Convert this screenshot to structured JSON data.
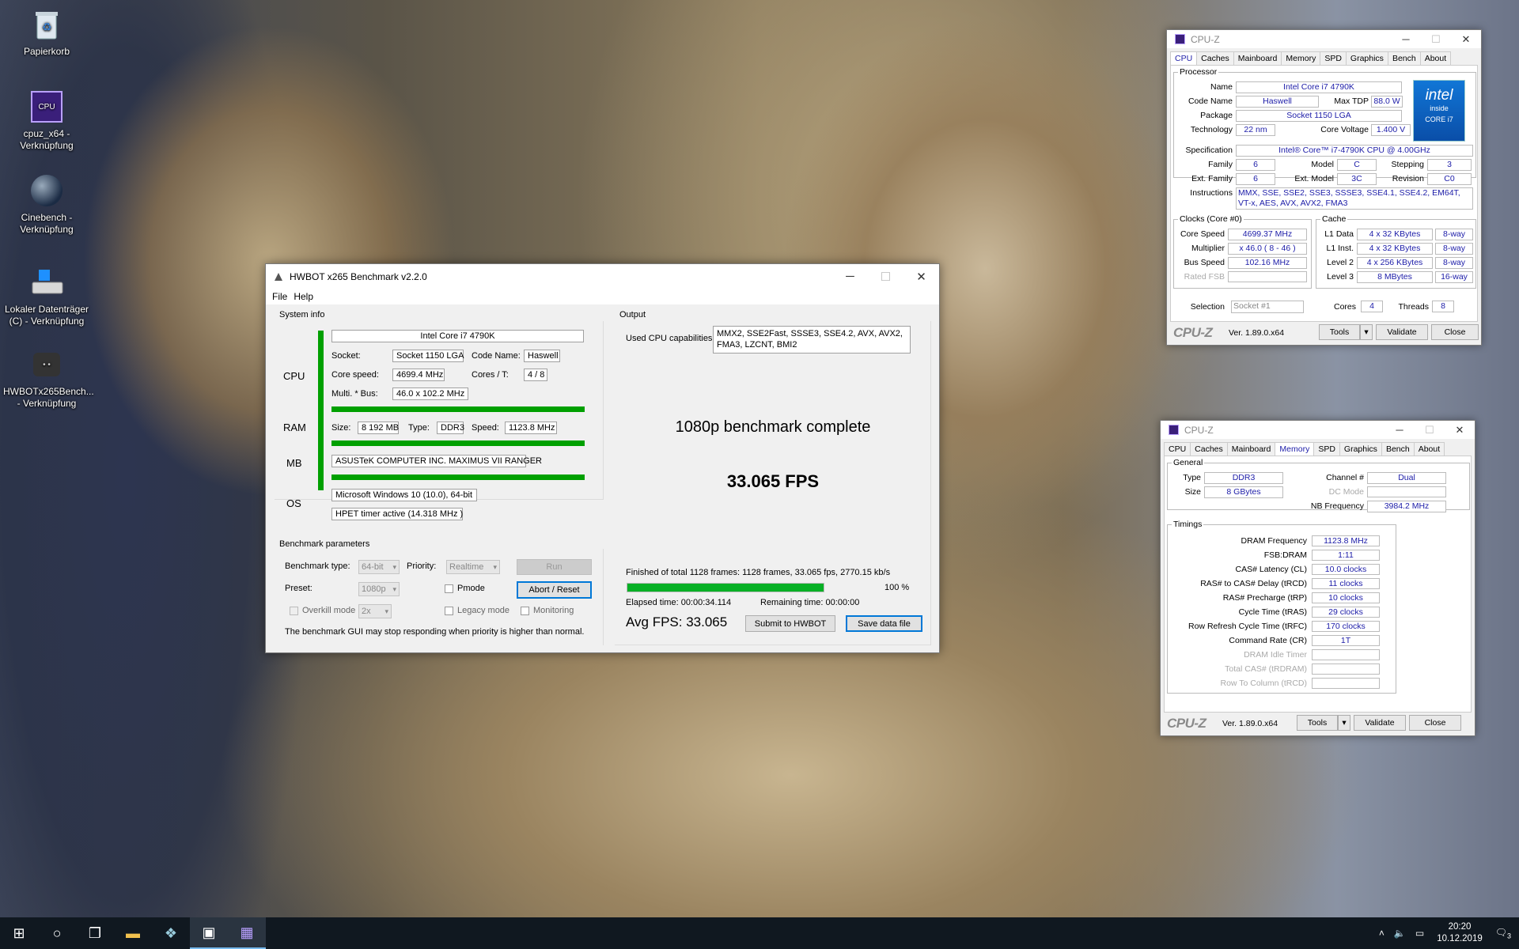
{
  "desktop": {
    "icons": [
      {
        "label": "Papierkorb",
        "icon": "recycle-bin-icon"
      },
      {
        "label": "cpuz_x64 - Verknüpfung",
        "icon": "cpuz-icon"
      },
      {
        "label": "Cinebench - Verknüpfung",
        "icon": "cinebench-icon"
      },
      {
        "label": "Lokaler Datenträger (C) - Verknüpfung",
        "icon": "drive-icon"
      },
      {
        "label": "HWBOTx265Bench... - Verknüpfung",
        "icon": "hwbot-icon"
      }
    ]
  },
  "hwbot": {
    "title": "HWBOT x265 Benchmark v2.2.0",
    "menu": [
      "File",
      "Help"
    ],
    "sysinfo": {
      "title": "System info",
      "cpu_label": "CPU",
      "ram_label": "RAM",
      "mb_label": "MB",
      "os_label": "OS",
      "cpu_name": "Intel Core i7 4790K",
      "socket_label": "Socket:",
      "socket": "Socket 1150 LGA",
      "codename_label": "Code Name:",
      "codename": "Haswell",
      "corespeed_label": "Core speed:",
      "corespeed": "4699.4 MHz",
      "cores_label": "Cores / T:",
      "cores": "4 / 8",
      "multi_label": "Multi. * Bus:",
      "multi": "46.0 x 102.2 MHz",
      "size_label": "Size:",
      "size": "8 192 MB",
      "type_label": "Type:",
      "type": "DDR3",
      "speed_label": "Speed:",
      "speed": "1123.8 MHz",
      "mb": "ASUSTeK COMPUTER INC. MAXIMUS VII RANGER",
      "os": "Microsoft Windows 10 (10.0), 64-bit",
      "timer": "HPET timer active (14.318 MHz )"
    },
    "params": {
      "title": "Benchmark parameters",
      "type_label": "Benchmark type:",
      "type": "64-bit",
      "priority_label": "Priority:",
      "priority": "Realtime",
      "run": "Run",
      "preset_label": "Preset:",
      "preset": "1080p",
      "pmode": "Pmode",
      "abort": "Abort / Reset",
      "overkill": "Overkill mode",
      "overkill_val": "2x",
      "legacy": "Legacy mode",
      "monitoring": "Monitoring",
      "note": "The benchmark GUI may stop responding when priority is higher than normal."
    },
    "output": {
      "title": "Output",
      "caps_label": "Used CPU capabilities:",
      "caps": "MMX2, SSE2Fast, SSSE3, SSE4.2, AVX, AVX2, FMA3, LZCNT, BMI2",
      "status": "1080p benchmark complete",
      "fps": "33.065 FPS",
      "finished": "Finished of total 1128 frames: 1128 frames, 33.065 fps,  2770.15 kb/s",
      "progress": 1.0,
      "progress_text": "100 %",
      "elapsed": "Elapsed time: 00:00:34.114",
      "remaining": "Remaining time: 00:00:00",
      "avg": "Avg FPS: 33.065",
      "submit": "Submit to HWBOT",
      "save": "Save data file"
    }
  },
  "cpuz_cpu": {
    "title": "CPU-Z",
    "tabs": [
      "CPU",
      "Caches",
      "Mainboard",
      "Memory",
      "SPD",
      "Graphics",
      "Bench",
      "About"
    ],
    "active": "CPU",
    "processor": "Processor",
    "name_l": "Name",
    "name": "Intel Core i7 4790K",
    "code_l": "Code Name",
    "code": "Haswell",
    "tdp_l": "Max TDP",
    "tdp": "88.0 W",
    "pkg_l": "Package",
    "pkg": "Socket 1150 LGA",
    "tech_l": "Technology",
    "tech": "22 nm",
    "volt_l": "Core Voltage",
    "volt": "1.400 V",
    "spec_l": "Specification",
    "spec": "Intel® Core™ i7-4790K CPU @ 4.00GHz",
    "fam_l": "Family",
    "fam": "6",
    "model_l": "Model",
    "model": "C",
    "step_l": "Stepping",
    "step": "3",
    "efam_l": "Ext. Family",
    "efam": "6",
    "emodel_l": "Ext. Model",
    "emodel": "3C",
    "rev_l": "Revision",
    "rev": "C0",
    "instr_l": "Instructions",
    "instr": "MMX, SSE, SSE2, SSE3, SSSE3, SSE4.1, SSE4.2, EM64T, VT-x, AES, AVX, AVX2, FMA3",
    "clocks": "Clocks (Core #0)",
    "cs_l": "Core Speed",
    "cs": "4699.37 MHz",
    "mult_l": "Multiplier",
    "mult": "x 46.0 ( 8 - 46 )",
    "bus_l": "Bus Speed",
    "bus": "102.16 MHz",
    "fsb_l": "Rated FSB",
    "cache": "Cache",
    "l1d_l": "L1 Data",
    "l1d": "4 x 32 KBytes",
    "l1d_w": "8-way",
    "l1i_l": "L1 Inst.",
    "l1i": "4 x 32 KBytes",
    "l1i_w": "8-way",
    "l2_l": "Level 2",
    "l2": "4 x 256 KBytes",
    "l2_w": "8-way",
    "l3_l": "Level 3",
    "l3": "8 MBytes",
    "l3_w": "16-way",
    "sel_l": "Selection",
    "sel": "Socket #1",
    "cores_l": "Cores",
    "cores": "4",
    "threads_l": "Threads",
    "threads": "8",
    "intel1": "intel",
    "intel2": "inside",
    "intel3": "CORE i7",
    "logo": "CPU-Z",
    "ver": "Ver. 1.89.0.x64",
    "tools": "Tools",
    "validate": "Validate",
    "close": "Close"
  },
  "cpuz_mem": {
    "title": "CPU-Z",
    "tabs": [
      "CPU",
      "Caches",
      "Mainboard",
      "Memory",
      "SPD",
      "Graphics",
      "Bench",
      "About"
    ],
    "active": "Memory",
    "general": "General",
    "type_l": "Type",
    "type": "DDR3",
    "ch_l": "Channel #",
    "ch": "Dual",
    "size_l": "Size",
    "size": "8 GBytes",
    "dc_l": "DC Mode",
    "nb_l": "NB Frequency",
    "nb": "3984.2 MHz",
    "timings": "Timings",
    "t": [
      {
        "l": "DRAM Frequency",
        "v": "1123.8 MHz"
      },
      {
        "l": "FSB:DRAM",
        "v": "1:11"
      },
      {
        "l": "CAS# Latency (CL)",
        "v": "10.0 clocks"
      },
      {
        "l": "RAS# to CAS# Delay (tRCD)",
        "v": "11 clocks"
      },
      {
        "l": "RAS# Precharge (tRP)",
        "v": "10 clocks"
      },
      {
        "l": "Cycle Time (tRAS)",
        "v": "29 clocks"
      },
      {
        "l": "Row Refresh Cycle Time (tRFC)",
        "v": "170 clocks"
      },
      {
        "l": "Command Rate (CR)",
        "v": "1T"
      },
      {
        "l": "DRAM Idle Timer",
        "v": ""
      },
      {
        "l": "Total CAS# (tRDRAM)",
        "v": ""
      },
      {
        "l": "Row To Column (tRCD)",
        "v": ""
      }
    ],
    "logo": "CPU-Z",
    "ver": "Ver. 1.89.0.x64",
    "tools": "Tools",
    "validate": "Validate",
    "close": "Close"
  },
  "taskbar": {
    "time": "20:20",
    "date": "10.12.2019",
    "notif": "3"
  }
}
